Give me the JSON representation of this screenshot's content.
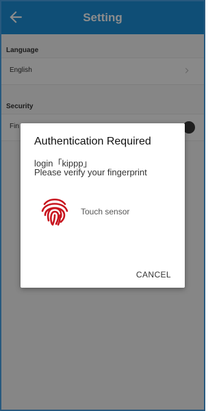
{
  "app": {
    "title": "Setting"
  },
  "sections": {
    "language": {
      "header": "Language",
      "value": "English"
    },
    "security": {
      "header": "Security",
      "item_label_partial": "Fin"
    }
  },
  "dialog": {
    "title": "Authentication Required",
    "line1": "login「kippp」",
    "line2": "Please verify your fingerprint",
    "sensor_text": "Touch sensor",
    "cancel_label": "CANCEL"
  },
  "colors": {
    "appbar": "#1c8fd8",
    "fingerprint": "#c8141e"
  }
}
